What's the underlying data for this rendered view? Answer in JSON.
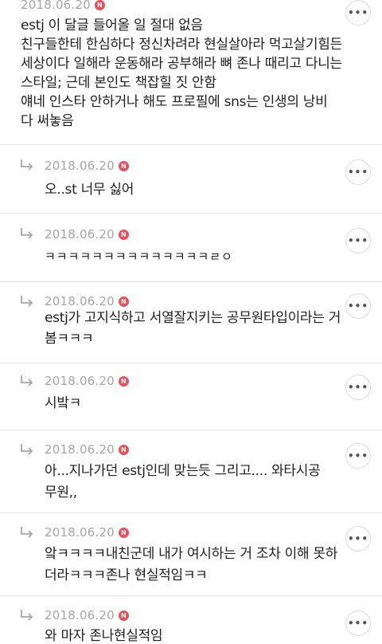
{
  "colors": {
    "badge": "#e8505b",
    "date_text": "#a6a6a6",
    "divider": "#e4e4e4"
  },
  "icons": {
    "reply": "reply-arrow-icon",
    "more": "more-options-icon",
    "badge": "new-badge-icon"
  },
  "main_comment": {
    "date": "2018.06.20",
    "badge": "N",
    "lines": [
      "estj 이 달글 들어올 일 절대 없음",
      "친구들한테 한심하다 정신차려라 현실살아라 먹고살기힘든",
      "세상이다 일해라 운동해라 공부해라 뼈 존나 때리고 다니는",
      "스타일; 근데 본인도 책잡힐 짓 안함",
      "얘네 인스타 안하거나 해도 프로필에 sns는 인생의 낭비",
      "다 써놓음"
    ],
    "more_label": "•••"
  },
  "replies": [
    {
      "date": "2018.06.20",
      "badge": "N",
      "lines": [
        "오..st 너무 싫어"
      ],
      "more_label": "•••"
    },
    {
      "date": "2018.06.20",
      "badge": "N",
      "lines": [
        "ㅋㅋㅋㅋㅋㅋㅋㅋㅋㅋㅋㅋㅋㅋㄹㅇ"
      ],
      "more_label": "•••"
    },
    {
      "date": "2018.06.20",
      "badge": "N",
      "lines": [
        "estj가 고지식하고 서열잘지키는 공무원타입이라는 거",
        "봄ㅋㅋㅋ"
      ],
      "more_label": "•••"
    },
    {
      "date": "2018.06.20",
      "badge": "N",
      "lines": [
        "시밬ㅋ"
      ],
      "more_label": "•••"
    },
    {
      "date": "2018.06.20",
      "badge": "N",
      "lines": [
        "아...지나가던 estj인데 맞는듯 그리고.... 와타시공",
        "무원,,"
      ],
      "more_label": "•••"
    },
    {
      "date": "2018.06.20",
      "badge": "N",
      "lines": [
        "앜ㅋㅋㅋㅋ내친군데 내가 여시하는 거 조차 이해 못하",
        "더라ㅋㅋㅋ존나 현실적임ㅋㅋ"
      ],
      "more_label": "•••"
    },
    {
      "date": "2018.06.20",
      "badge": "N",
      "lines": [
        "와 마자 존나현실적임"
      ],
      "more_label": "•••"
    }
  ]
}
